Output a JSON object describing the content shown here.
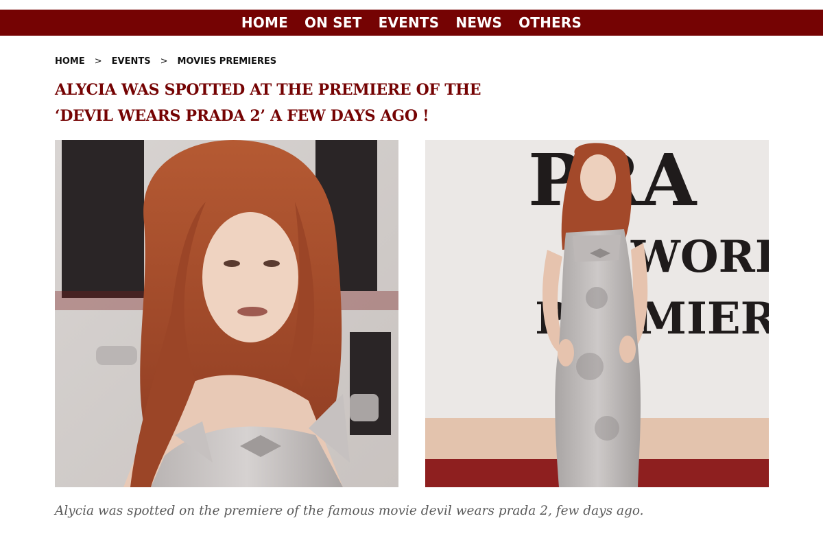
{
  "nav": {
    "items": [
      "HOME",
      "ON SET",
      "EVENTS",
      "NEWS",
      "OTHERS"
    ]
  },
  "breadcrumb": {
    "items": [
      "HOME",
      "EVENTS",
      "MOVIES PREMIERES"
    ],
    "separator": ">"
  },
  "post": {
    "title": "ALYCIA WAS SPOTTED AT THE PREMIERE OF THE ‘DEVIL WEARS PRADA 2’ A FEW DAYS AGO !",
    "caption": "Alycia was spotted on the premiere of the famous movie devil wears prada 2, few days ago."
  },
  "images": {
    "right_backdrop_text": [
      "PRA",
      "WORLD",
      "PREMIER"
    ]
  },
  "colors": {
    "brand": "#750303",
    "text": "#111111",
    "caption": "#5a5a5a",
    "hair": "#a5462a"
  }
}
